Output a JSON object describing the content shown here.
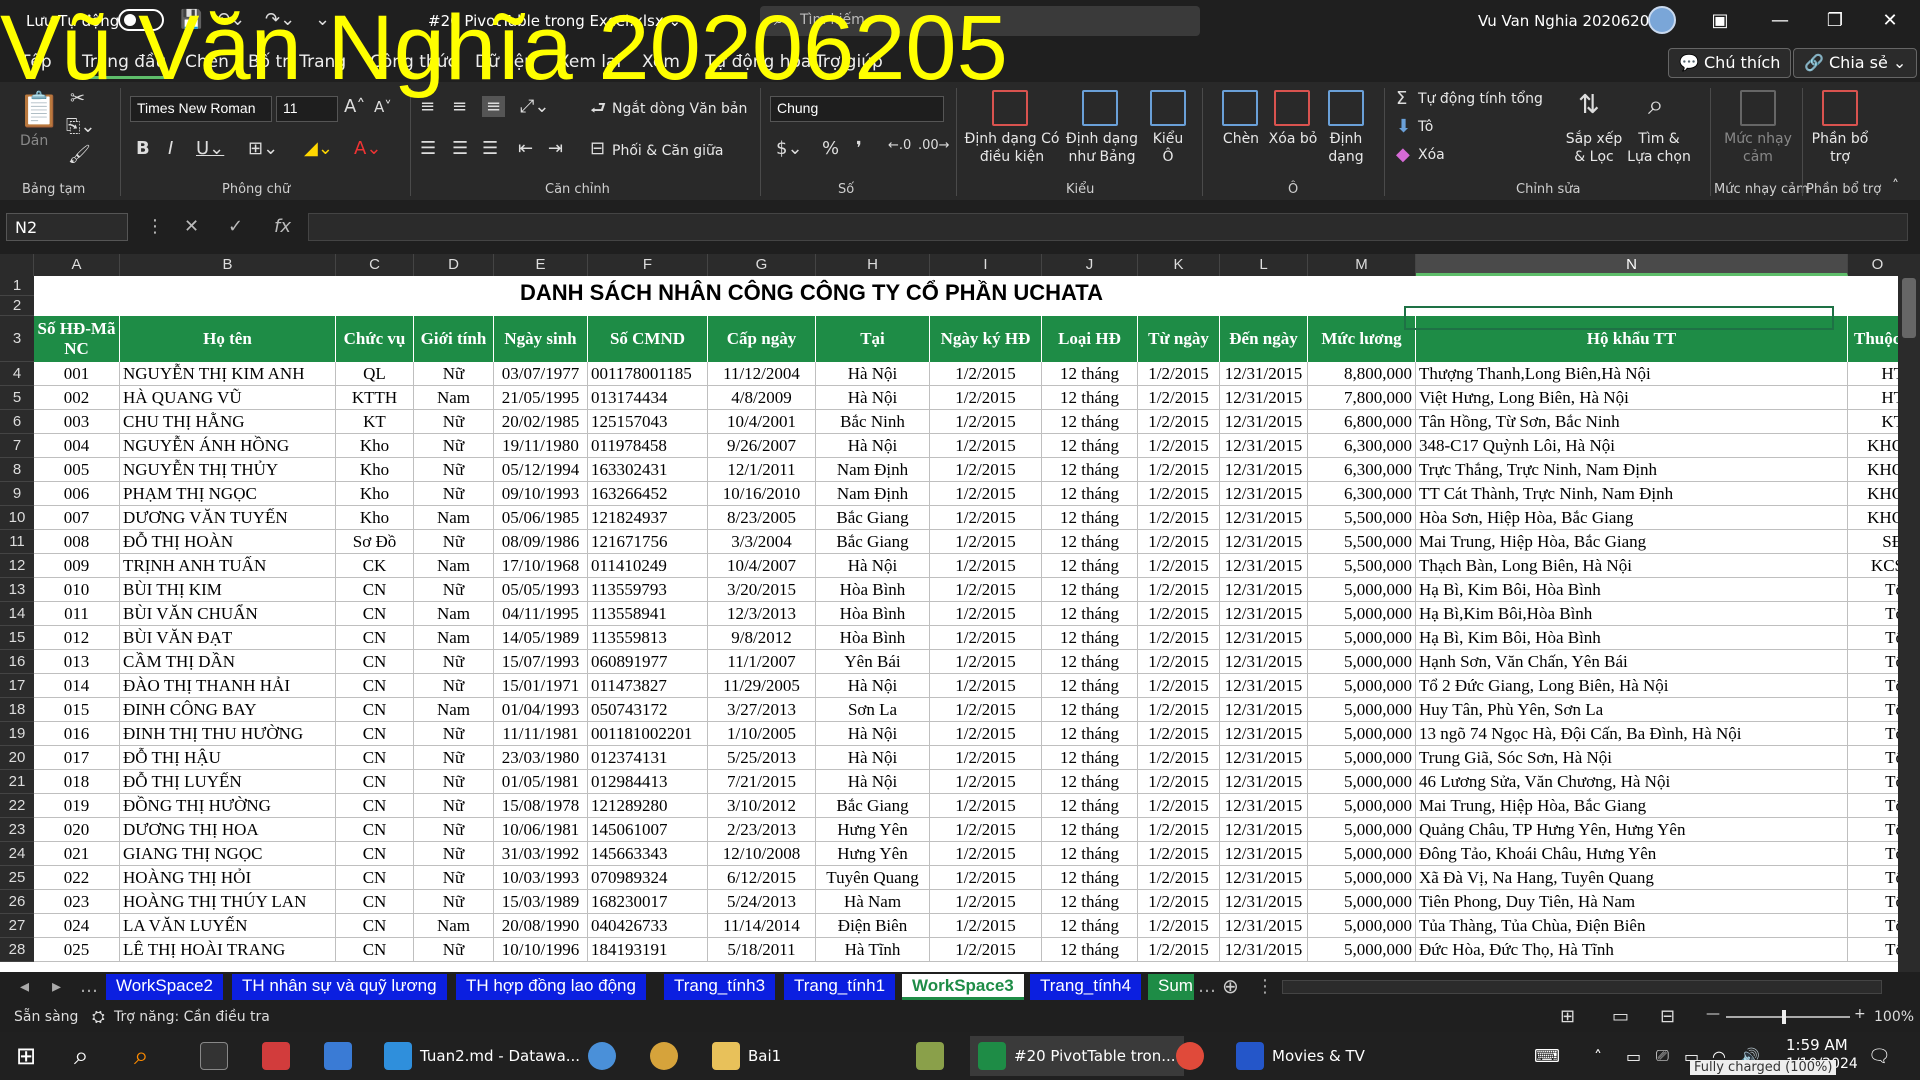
{
  "titlebar": {
    "autosave": "Lưu Tự động",
    "doc": "#20 PivotTable trong Excel.xlsx ⌄",
    "search": "Tìm kiếm",
    "user": "Vu Van Nghia 20206205"
  },
  "watermark": "Vũ Văn Nghĩa 20206205",
  "tabs": [
    "Tệp",
    "Trang đầu",
    "Chèn",
    "Bố trí Trang",
    "Công thức",
    "Dữ liệu",
    "Xem lại",
    "Xem",
    "Tự động hóa",
    "Trợ giúp"
  ],
  "ribbon_buttons": {
    "comments": "💬 Chú thích",
    "share": "🔗 Chia sẻ ⌄"
  },
  "ribbon": {
    "paste": "Dán",
    "clipboard": "Bảng tạm",
    "font": "Times New Roman",
    "size": "11",
    "font_group": "Phông chữ",
    "wrap": "Ngắt dòng Văn bản",
    "merge": "Phối & Căn giữa",
    "align_group": "Căn chỉnh",
    "numfmt": "Chung",
    "number_group": "Số",
    "cond": "Định dạng Có điều kiện",
    "table": "Định dạng như Bảng",
    "styles": "Kiểu Ô",
    "styles_group": "Kiểu",
    "insert": "Chèn",
    "delete": "Xóa bỏ",
    "format": "Định dạng",
    "cells_group": "Ô",
    "autosum": "Tự động tính tổng",
    "fill": "Tô",
    "clear": "Xóa",
    "sort": "Sắp xếp & Lọc",
    "find": "Tìm & Lựa chọn",
    "edit_group": "Chỉnh sửa",
    "sens": "Mức nhạy cảm",
    "sens_group": "Mức nhạy cảm",
    "analyze": "Phần bổ trợ",
    "analyze_group": "Phần bổ trợ"
  },
  "namebox": "N2",
  "columns": [
    "A",
    "B",
    "C",
    "D",
    "E",
    "F",
    "G",
    "H",
    "I",
    "J",
    "K",
    "L",
    "M",
    "N",
    "O"
  ],
  "sheet_title": "DANH SÁCH NHÂN CÔNG CÔNG TY CỔ PHẦN UCHATA",
  "headers": [
    "Số HĐ-Mã NC",
    "Họ tên",
    "Chức vụ",
    "Giới tính",
    "Ngày sinh",
    "Số CMND",
    "Cấp ngày",
    "Tại",
    "Ngày ký HĐ",
    "Loại HĐ",
    "Từ ngày",
    "Đến ngày",
    "Mức lương",
    "Hộ khẩu TT",
    "Thuộc"
  ],
  "rows": [
    [
      "001",
      "NGUYỄN THỊ KIM ANH",
      "QL",
      "Nữ",
      "03/07/1977",
      "001178001185",
      "11/12/2004",
      "Hà Nội",
      "1/2/2015",
      "12 tháng",
      "1/2/2015",
      "12/31/2015",
      "8,800,000",
      "Thượng Thanh,Long Biên,Hà Nội",
      "HT"
    ],
    [
      "002",
      "HÀ QUANG VŨ",
      "KTTH",
      "Nam",
      "21/05/1995",
      "013174434",
      "4/8/2009",
      "Hà Nội",
      "1/2/2015",
      "12 tháng",
      "1/2/2015",
      "12/31/2015",
      "7,800,000",
      "Việt Hưng, Long Biên, Hà Nội",
      "HT"
    ],
    [
      "003",
      "CHU THỊ HẰNG",
      "KT",
      "Nữ",
      "20/02/1985",
      "125157043",
      "10/4/2001",
      "Bắc Ninh",
      "1/2/2015",
      "12 tháng",
      "1/2/2015",
      "12/31/2015",
      "6,800,000",
      "Tân Hồng, Từ Sơn, Bắc Ninh",
      "KT"
    ],
    [
      "004",
      "NGUYỄN ÁNH HỒNG",
      "Kho",
      "Nữ",
      "19/11/1980",
      "011978458",
      "9/26/2007",
      "Hà Nội",
      "1/2/2015",
      "12 tháng",
      "1/2/2015",
      "12/31/2015",
      "6,300,000",
      "348-C17 Quỳnh Lôi, Hà Nội",
      "KHO"
    ],
    [
      "005",
      "NGUYỄN THỊ THỦY",
      "Kho",
      "Nữ",
      "05/12/1994",
      "163302431",
      "12/1/2011",
      "Nam Định",
      "1/2/2015",
      "12 tháng",
      "1/2/2015",
      "12/31/2015",
      "6,300,000",
      "Trực Thắng, Trực Ninh, Nam Định",
      "KHO"
    ],
    [
      "006",
      "PHẠM THỊ NGỌC",
      "Kho",
      "Nữ",
      "09/10/1993",
      "163266452",
      "10/16/2010",
      "Nam Định",
      "1/2/2015",
      "12 tháng",
      "1/2/2015",
      "12/31/2015",
      "6,300,000",
      "TT Cát Thành, Trực Ninh, Nam Định",
      "KHO"
    ],
    [
      "007",
      "DƯƠNG VĂN TUYẾN",
      "Kho",
      "Nam",
      "05/06/1985",
      "121824937",
      "8/23/2005",
      "Bắc Giang",
      "1/2/2015",
      "12 tháng",
      "1/2/2015",
      "12/31/2015",
      "5,500,000",
      "Hòa Sơn, Hiệp Hòa, Bắc Giang",
      "KHO"
    ],
    [
      "008",
      "ĐỖ THỊ HOÀN",
      "Sơ Đồ",
      "Nữ",
      "08/09/1986",
      "121671756",
      "3/3/2004",
      "Bắc Giang",
      "1/2/2015",
      "12 tháng",
      "1/2/2015",
      "12/31/2015",
      "5,500,000",
      "Mai Trung, Hiệp Hòa, Bắc Giang",
      "SĐ"
    ],
    [
      "009",
      "TRỊNH ANH TUẤN",
      "CK",
      "Nam",
      "17/10/1968",
      "011410249",
      "10/4/2007",
      "Hà Nội",
      "1/2/2015",
      "12 tháng",
      "1/2/2015",
      "12/31/2015",
      "5,500,000",
      "Thạch Bàn, Long Biên, Hà Nội",
      "KCS"
    ],
    [
      "010",
      "BÙI THỊ KIM",
      "CN",
      "Nữ",
      "05/05/1993",
      "113559793",
      "3/20/2015",
      "Hòa Bình",
      "1/2/2015",
      "12 tháng",
      "1/2/2015",
      "12/31/2015",
      "5,000,000",
      "Hạ Bì, Kim Bôi, Hòa Bình",
      "Tổ"
    ],
    [
      "011",
      "BÙI VĂN CHUẨN",
      "CN",
      "Nam",
      "04/11/1995",
      "113558941",
      "12/3/2013",
      "Hòa Bình",
      "1/2/2015",
      "12 tháng",
      "1/2/2015",
      "12/31/2015",
      "5,000,000",
      "Hạ Bì,Kim Bôi,Hòa Bình",
      "Tổ"
    ],
    [
      "012",
      "BÙI VĂN ĐẠT",
      "CN",
      "Nam",
      "14/05/1989",
      "113559813",
      "9/8/2012",
      "Hòa Bình",
      "1/2/2015",
      "12 tháng",
      "1/2/2015",
      "12/31/2015",
      "5,000,000",
      "Hạ Bì, Kim Bôi, Hòa Bình",
      "Tổ"
    ],
    [
      "013",
      "CẦM THỊ DẦN",
      "CN",
      "Nữ",
      "15/07/1993",
      "060891977",
      "11/1/2007",
      "Yên Bái",
      "1/2/2015",
      "12 tháng",
      "1/2/2015",
      "12/31/2015",
      "5,000,000",
      "Hạnh Sơn, Văn Chấn, Yên Bái",
      "Tổ"
    ],
    [
      "014",
      "ĐÀO THỊ THANH HẢI",
      "CN",
      "Nữ",
      "15/01/1971",
      "011473827",
      "11/29/2005",
      "Hà Nội",
      "1/2/2015",
      "12 tháng",
      "1/2/2015",
      "12/31/2015",
      "5,000,000",
      "Tổ 2 Đức Giang, Long Biên, Hà Nội",
      "Tổ"
    ],
    [
      "015",
      "ĐINH CÔNG BAY",
      "CN",
      "Nam",
      "01/04/1993",
      "050743172",
      "3/27/2013",
      "Sơn La",
      "1/2/2015",
      "12 tháng",
      "1/2/2015",
      "12/31/2015",
      "5,000,000",
      "Huy Tân, Phù Yên, Sơn La",
      "Tổ"
    ],
    [
      "016",
      "ĐINH THỊ THU HƯỜNG",
      "CN",
      "Nữ",
      "11/11/1981",
      "001181002201",
      "1/10/2005",
      "Hà Nội",
      "1/2/2015",
      "12 tháng",
      "1/2/2015",
      "12/31/2015",
      "5,000,000",
      "13 ngõ 74 Ngọc Hà, Đội Cấn, Ba Đình, Hà Nội",
      "Tổ"
    ],
    [
      "017",
      "ĐỖ THỊ HẬU",
      "CN",
      "Nữ",
      "23/03/1980",
      "012374131",
      "5/25/2013",
      "Hà Nội",
      "1/2/2015",
      "12 tháng",
      "1/2/2015",
      "12/31/2015",
      "5,000,000",
      "Trung Giã, Sóc Sơn, Hà Nội",
      "Tổ"
    ],
    [
      "018",
      "ĐỖ THỊ LUYẾN",
      "CN",
      "Nữ",
      "01/05/1981",
      "012984413",
      "7/21/2015",
      "Hà Nội",
      "1/2/2015",
      "12 tháng",
      "1/2/2015",
      "12/31/2015",
      "5,000,000",
      "46 Lương Sửa, Văn Chương, Hà Nội",
      "Tổ"
    ],
    [
      "019",
      "ĐỒNG THỊ HƯỜNG",
      "CN",
      "Nữ",
      "15/08/1978",
      "121289280",
      "3/10/2012",
      "Bắc Giang",
      "1/2/2015",
      "12 tháng",
      "1/2/2015",
      "12/31/2015",
      "5,000,000",
      "Mai Trung, Hiệp Hòa, Bắc Giang",
      "Tổ"
    ],
    [
      "020",
      "DƯƠNG THỊ HOA",
      "CN",
      "Nữ",
      "10/06/1981",
      "145061007",
      "2/23/2013",
      "Hưng Yên",
      "1/2/2015",
      "12 tháng",
      "1/2/2015",
      "12/31/2015",
      "5,000,000",
      "Quảng Châu, TP Hưng Yên, Hưng Yên",
      "Tổ"
    ],
    [
      "021",
      "GIANG THỊ NGỌC",
      "CN",
      "Nữ",
      "31/03/1992",
      "145663343",
      "12/10/2008",
      "Hưng Yên",
      "1/2/2015",
      "12 tháng",
      "1/2/2015",
      "12/31/2015",
      "5,000,000",
      "Đông Tảo, Khoái Châu, Hưng Yên",
      "Tổ"
    ],
    [
      "022",
      "HOÀNG THỊ HỎI",
      "CN",
      "Nữ",
      "10/03/1993",
      "070989324",
      "6/12/2015",
      "Tuyên Quang",
      "1/2/2015",
      "12 tháng",
      "1/2/2015",
      "12/31/2015",
      "5,000,000",
      "Xã Đà Vị, Na Hang, Tuyên Quang",
      "Tổ"
    ],
    [
      "023",
      "HOÀNG THỊ THÚY LAN",
      "CN",
      "Nữ",
      "15/03/1989",
      "168230017",
      "5/24/2013",
      "Hà Nam",
      "1/2/2015",
      "12 tháng",
      "1/2/2015",
      "12/31/2015",
      "5,000,000",
      "Tiên Phong, Duy Tiên, Hà Nam",
      "Tổ"
    ],
    [
      "024",
      "LA VĂN LUYẾN",
      "CN",
      "Nam",
      "20/08/1990",
      "040426733",
      "11/14/2014",
      "Điện Biên",
      "1/2/2015",
      "12 tháng",
      "1/2/2015",
      "12/31/2015",
      "5,000,000",
      "Tủa Thàng, Tủa Chùa, Điện Biên",
      "Tổ"
    ],
    [
      "025",
      "LÊ THỊ HOÀI TRANG",
      "CN",
      "Nữ",
      "10/10/1996",
      "184193191",
      "5/18/2011",
      "Hà Tĩnh",
      "1/2/2015",
      "12 tháng",
      "1/2/2015",
      "12/31/2015",
      "5,000,000",
      "Đức Hòa, Đức Thọ, Hà Tĩnh",
      "Tổ"
    ]
  ],
  "sheet_tabs": [
    "WorkSpace2",
    "TH nhân sự và quỹ lương",
    "TH hợp đồng lao động",
    "Trang_tính3",
    "Trang_tính1",
    "WorkSpace3",
    "Trang_tính4",
    "Sum"
  ],
  "active_sheet": "WorkSpace3",
  "status": {
    "ready": "Sẵn sàng",
    "access": "Trợ năng: Cần điều tra",
    "zoom": "100%"
  },
  "taskbar": {
    "vscode": "Tuan2.md - Datawa...",
    "folder": "Bai1",
    "excel": "#20 PivotTable tron...",
    "movies": "Movies & TV",
    "time": "1:59 AM",
    "date": "1/10/2024",
    "battery": "Fully charged (100%)"
  }
}
